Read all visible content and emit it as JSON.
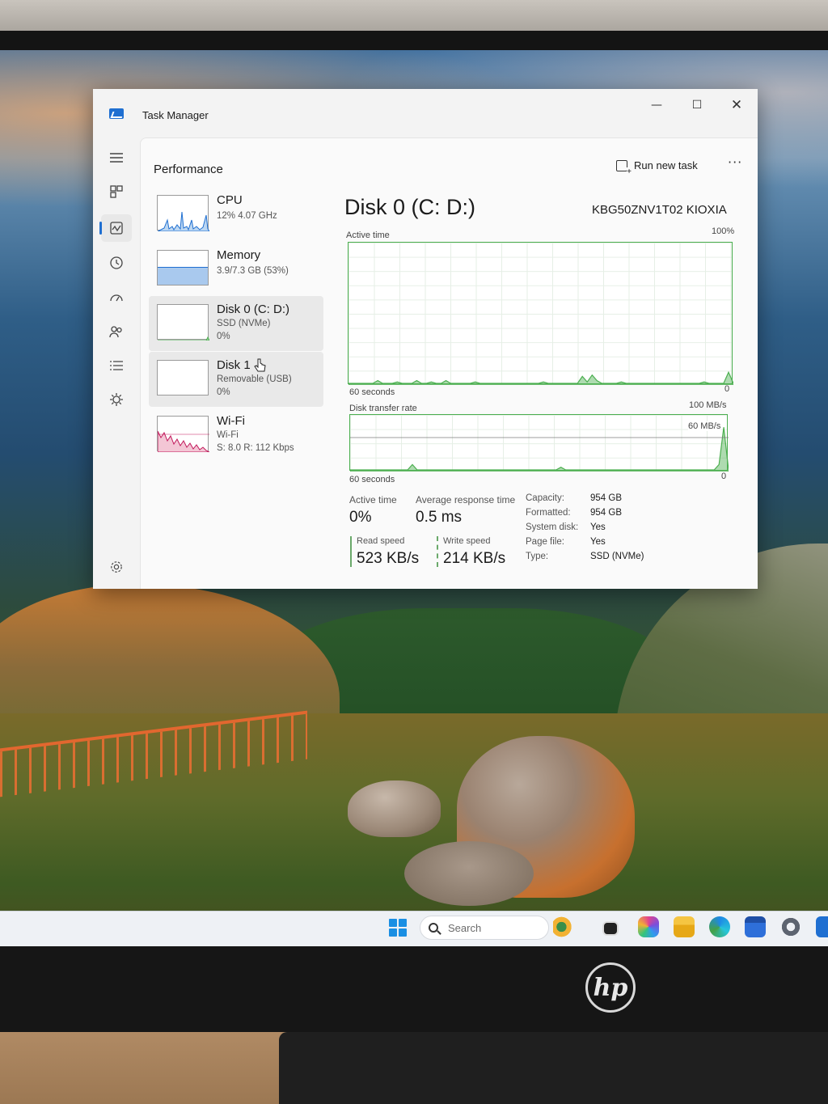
{
  "window": {
    "title": "Task Manager",
    "controls": {
      "minimize": "—",
      "maximize": "☐",
      "close": "✕"
    }
  },
  "header": {
    "section_title": "Performance",
    "run_new_task": "Run new task",
    "more": "···"
  },
  "nav": {
    "items": [
      "menu-icon",
      "processes-icon",
      "performance-icon",
      "app-history-icon",
      "startup-apps-icon",
      "users-icon",
      "details-icon",
      "services-icon"
    ],
    "active": "performance-icon",
    "settings": "settings-icon"
  },
  "devices": [
    {
      "name": "CPU",
      "sub1": "12%  4.07 GHz",
      "sub2": ""
    },
    {
      "name": "Memory",
      "sub1": "3.9/7.3 GB (53%)",
      "sub2": ""
    },
    {
      "name": "Disk 0 (C: D:)",
      "sub1": "SSD (NVMe)",
      "sub2": "0%"
    },
    {
      "name": "Disk 1",
      "sub1": "Removable (USB)",
      "sub2": "0%"
    },
    {
      "name": "Wi-Fi",
      "sub1": "Wi-Fi",
      "sub2": "S: 8.0  R: 112 Kbps"
    }
  ],
  "selected_device": "Disk 0 (C: D:)",
  "detail": {
    "title": "Disk 0 (C: D:)",
    "model": "KBG50ZNV1T02 KIOXIA",
    "active_graph": {
      "label": "Active time",
      "max": "100%",
      "min": "0",
      "duration": "60 seconds",
      "values": [
        0,
        0,
        0,
        0,
        0,
        0,
        2,
        0,
        0,
        0,
        1,
        0,
        0,
        0,
        2,
        0,
        0,
        1,
        0,
        0,
        2,
        0,
        0,
        0,
        0,
        0,
        1,
        0,
        0,
        0,
        0,
        0,
        0,
        0,
        0,
        0,
        0,
        0,
        0,
        0,
        1,
        0,
        0,
        0,
        0,
        0,
        0,
        0,
        5,
        1,
        6,
        2,
        0,
        0,
        0,
        0,
        1,
        0,
        0,
        0,
        0,
        0,
        0,
        0,
        0,
        0,
        0,
        0,
        0,
        0,
        0,
        0,
        0,
        1,
        0,
        0,
        0,
        0,
        8,
        0
      ]
    },
    "transfer_graph": {
      "label": "Disk transfer rate",
      "max": "100 MB/s",
      "mid": "60 MB/s",
      "min": "0",
      "duration": "60 seconds",
      "values": [
        0,
        0,
        0,
        0,
        0,
        0,
        0,
        0,
        0,
        0,
        0,
        0,
        0,
        10,
        0,
        0,
        0,
        0,
        0,
        0,
        0,
        0,
        0,
        0,
        0,
        0,
        0,
        0,
        0,
        0,
        0,
        0,
        0,
        0,
        0,
        0,
        0,
        0,
        0,
        0,
        0,
        0,
        0,
        0,
        5,
        0,
        0,
        0,
        0,
        0,
        0,
        0,
        0,
        0,
        0,
        0,
        0,
        0,
        0,
        0,
        0,
        0,
        0,
        0,
        0,
        0,
        0,
        0,
        0,
        0,
        0,
        0,
        0,
        0,
        0,
        0,
        0,
        10,
        80,
        0
      ]
    },
    "stats": {
      "active_time_label": "Active time",
      "active_time": "0%",
      "avg_response_label": "Average response time",
      "avg_response": "0.5 ms",
      "read_speed_label": "Read speed",
      "read_speed": "523 KB/s",
      "write_speed_label": "Write speed",
      "write_speed": "214 KB/s"
    },
    "properties": [
      {
        "key": "Capacity:",
        "value": "954 GB"
      },
      {
        "key": "Formatted:",
        "value": "954 GB"
      },
      {
        "key": "System disk:",
        "value": "Yes"
      },
      {
        "key": "Page file:",
        "value": "Yes"
      },
      {
        "key": "Type:",
        "value": "SSD (NVMe)"
      }
    ]
  },
  "taskbar": {
    "search_placeholder": "Search",
    "pinned": [
      "start-icon",
      "search-box",
      "widgets-icon",
      "task-view-icon",
      "copilot-icon",
      "file-explorer-icon",
      "edge-icon",
      "store-icon",
      "settings-icon",
      "task-manager-icon"
    ]
  },
  "colors": {
    "accent": "#1f6fd1",
    "disk_graph": "#4caf50",
    "memory_fill": "#a9c9ee",
    "wifi_graph": "#c2185b"
  },
  "brand": "hp"
}
